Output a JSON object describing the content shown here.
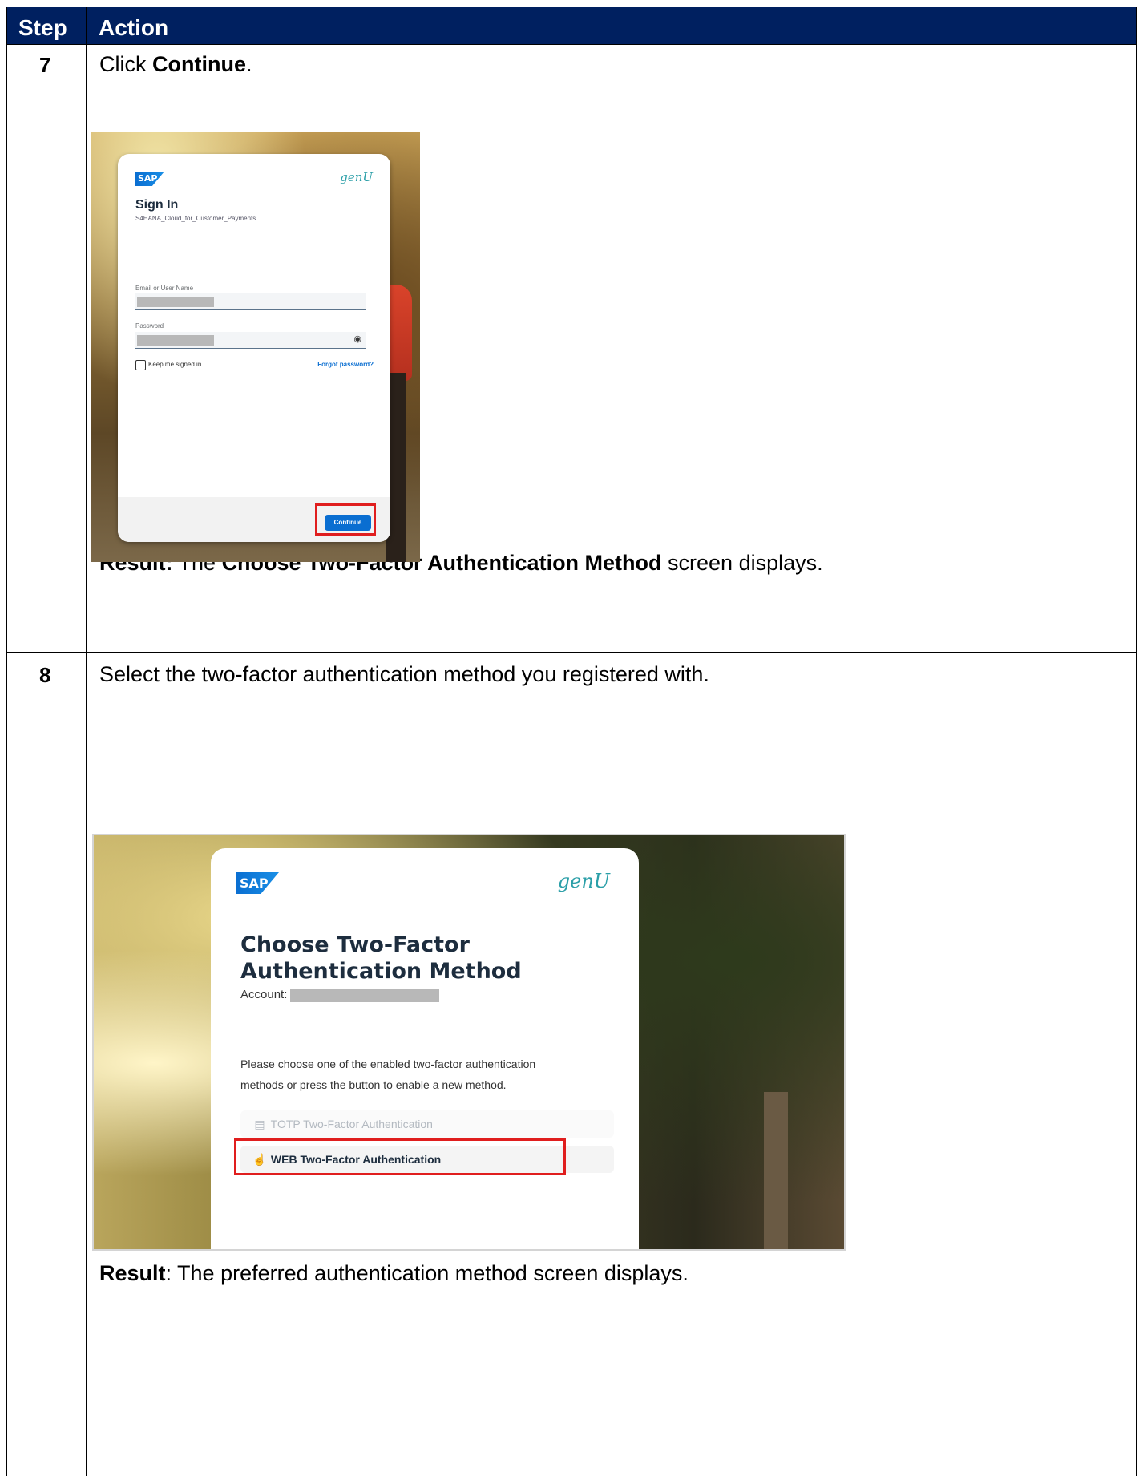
{
  "table": {
    "header_step": "Step",
    "header_action": "Action"
  },
  "row7": {
    "step": "7",
    "instruction_prefix": "Click ",
    "instruction_bold": "Continue",
    "instruction_suffix": ".",
    "result_label": "Result:",
    "result_pre": " The ",
    "result_bold": "Choose Two-Factor Authentication Method",
    "result_post": " screen displays.",
    "screenshot": {
      "sap_logo": "SAP",
      "brand": "genU",
      "title": "Sign In",
      "subtitle": "S4HANA_Cloud_for_Customer_Payments",
      "email_label": "Email or User Name",
      "password_label": "Password",
      "keep_signed_in": "Keep me signed in",
      "forgot_password": "Forgot password?",
      "continue_button": "Continue",
      "eye_icon": "eye-icon"
    }
  },
  "row8": {
    "step": "8",
    "instruction": "Select the two-factor authentication method you registered with.",
    "result_label": "Result",
    "result_text": ": The preferred authentication method screen displays.",
    "screenshot": {
      "sap_logo": "SAP",
      "brand": "genU",
      "title": "Choose Two-Factor Authentication Method",
      "account_label": "Account:",
      "description": "Please choose one of the enabled two-factor authentication methods or press the button to enable a new method.",
      "option_totp": "TOTP Two-Factor Authentication",
      "option_web": "WEB Two-Factor Authentication",
      "totp_icon": "calendar-icon",
      "web_icon": "touch-icon"
    }
  },
  "colors": {
    "header_bg": "#002060",
    "highlight": "#e01e1e",
    "sap_blue": "#0a6ed1"
  }
}
